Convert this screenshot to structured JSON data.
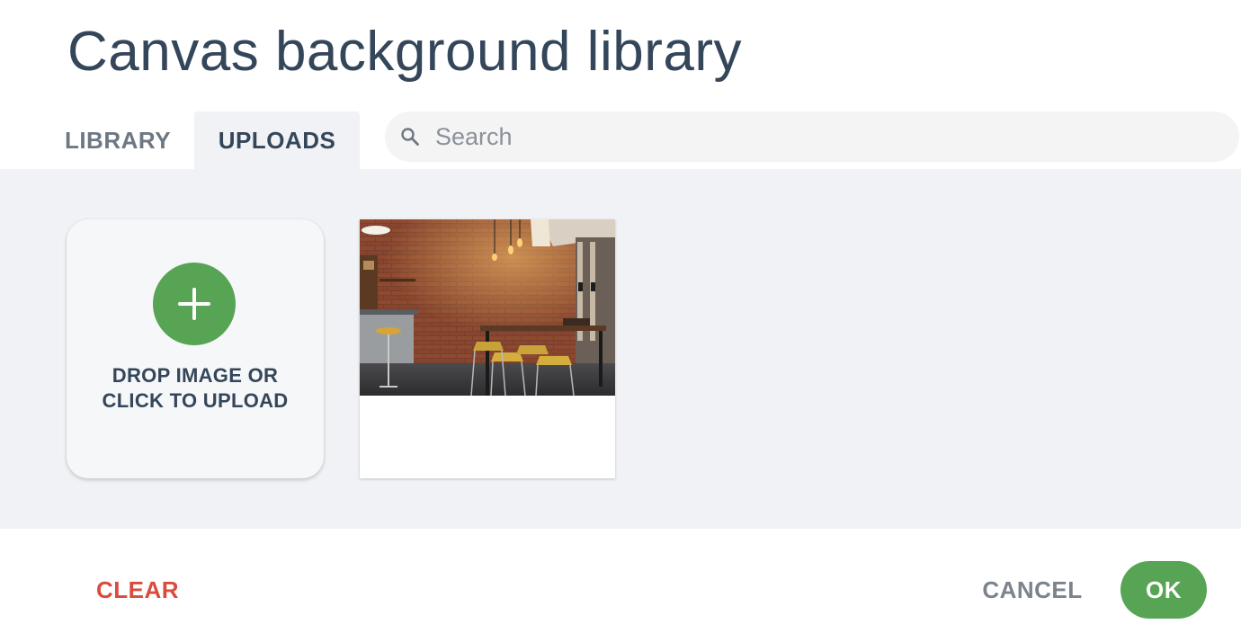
{
  "dialog": {
    "title": "Canvas background library"
  },
  "tabs": [
    {
      "label": "LIBRARY",
      "active": false
    },
    {
      "label": "UPLOADS",
      "active": true
    }
  ],
  "search": {
    "placeholder": "Search",
    "value": "",
    "icon": "search-icon"
  },
  "uploads": {
    "upload_tile": {
      "label": "DROP IMAGE OR CLICK TO UPLOAD",
      "icon": "plus-icon"
    },
    "images": [
      {
        "alt": "cafe interior with brick wall"
      }
    ]
  },
  "footer": {
    "clear_label": "CLEAR",
    "cancel_label": "CANCEL",
    "ok_label": "OK"
  },
  "colors": {
    "accent_green": "#57a455",
    "danger_red": "#d94c3d",
    "title_text": "#34465a",
    "panel_bg": "#f1f2f5"
  }
}
